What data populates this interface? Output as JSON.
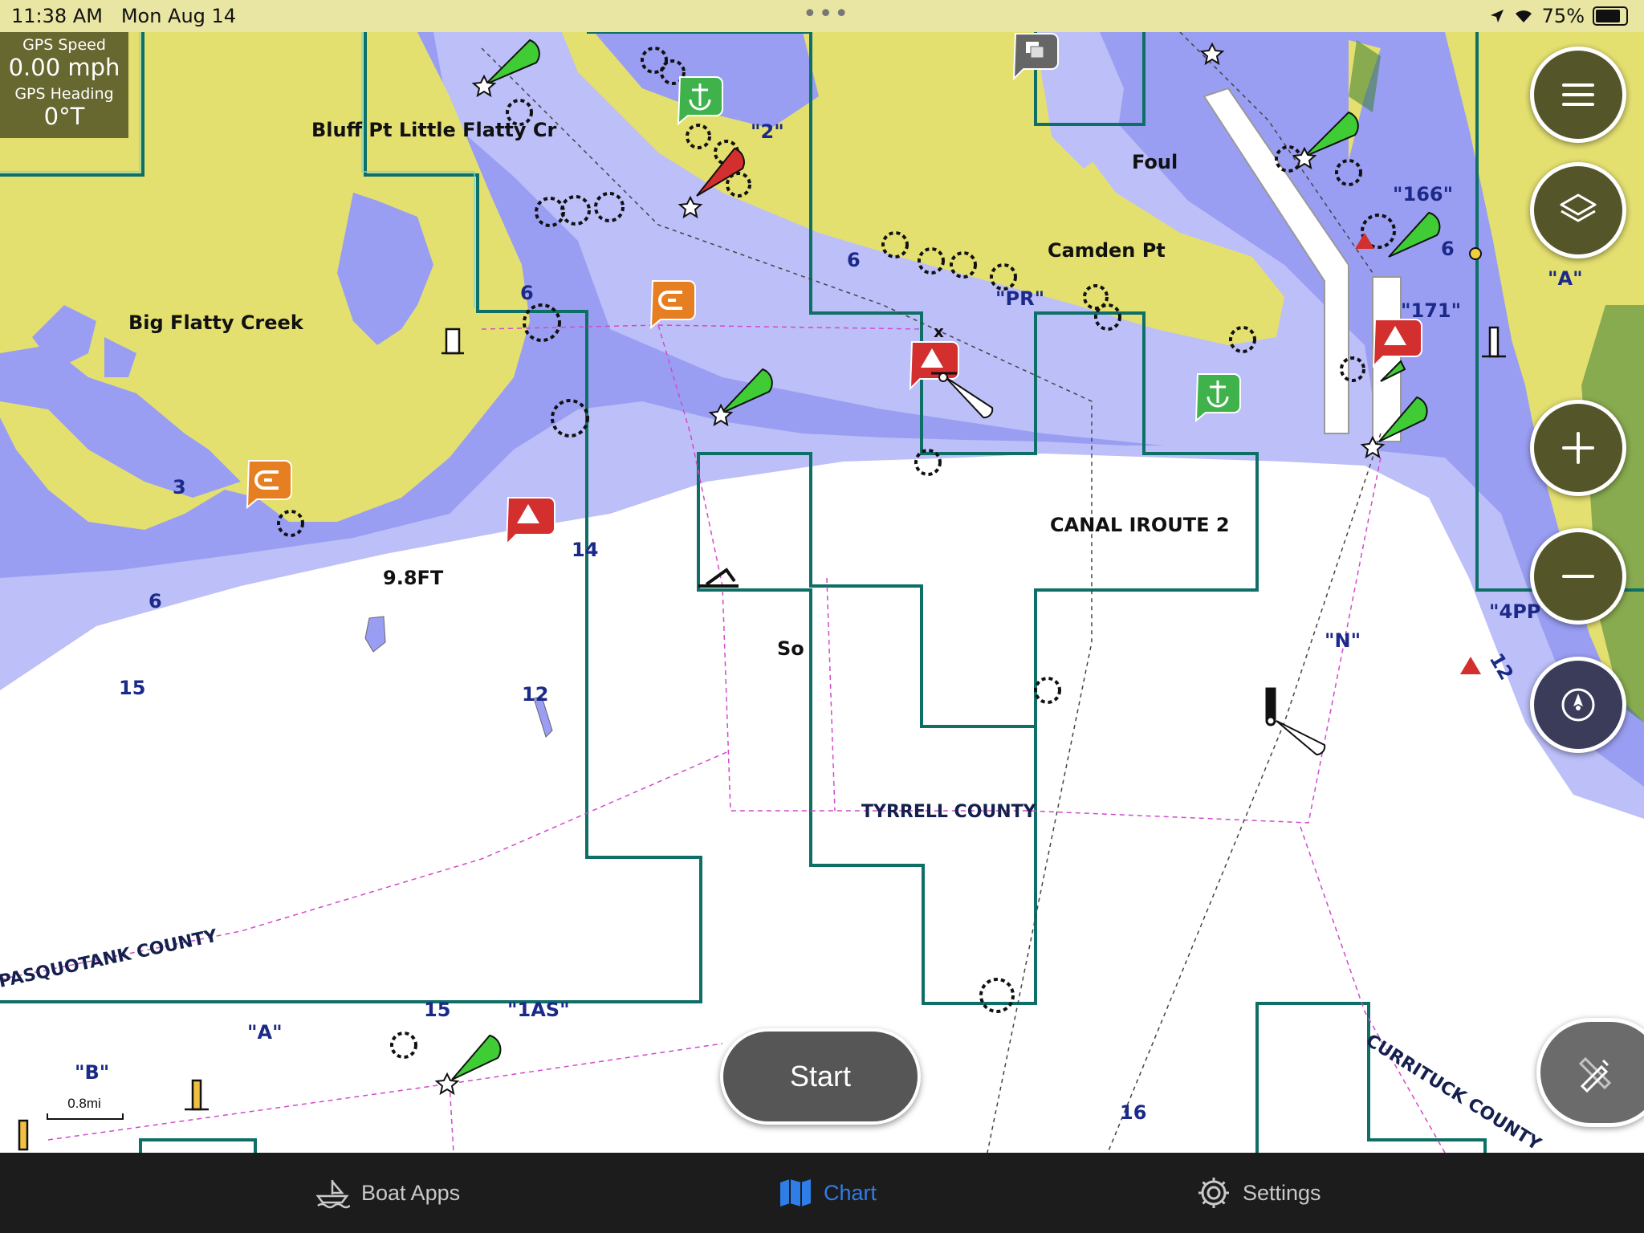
{
  "status_bar": {
    "time": "11:38 AM",
    "date": "Mon Aug 14",
    "battery": "75%"
  },
  "gps": {
    "speed_label": "GPS Speed",
    "speed_value": "0.00 mph",
    "heading_label": "GPS Heading",
    "heading_value": "0°T"
  },
  "map": {
    "place_labels": [
      "Bluff Pt Little Flatty Cr",
      "Big Flatty Creek",
      "Foul",
      "Camden Pt",
      "CANAL IROUTE 2",
      "So",
      "9.8FT"
    ],
    "county_labels": [
      "TYRRELL COUNTY",
      "PASQUOTANK COUNTY",
      "CURRITUCK COUNTY"
    ],
    "buoy_labels": [
      "\"2\"",
      "\"PR\"",
      "\"166\"",
      "\"171\"",
      "\"A\"",
      "\"4PP\"",
      "\"N\"",
      "\"A\"",
      "\"B\"",
      "\"1AS\""
    ],
    "soundings": [
      "6",
      "6",
      "6",
      "3",
      "6",
      "14",
      "15",
      "12",
      "15",
      "16",
      "12"
    ],
    "scale_label": "0.8mi"
  },
  "controls": {
    "start_label": "Start"
  },
  "tabs": [
    {
      "label": "Boat Apps",
      "icon": "boat-icon"
    },
    {
      "label": "Chart",
      "icon": "chart-icon",
      "active": true
    },
    {
      "label": "Settings",
      "icon": "gear-icon"
    }
  ],
  "colors": {
    "land": "#e4e070",
    "shallow_water": "#9a9ef2",
    "mid_water": "#bcbff8",
    "deep_water": "#ffffff",
    "accent": "#2f7de6",
    "marina": "#e67e22",
    "anchorage": "#3fb24b",
    "hazard": "#d32f2f"
  }
}
